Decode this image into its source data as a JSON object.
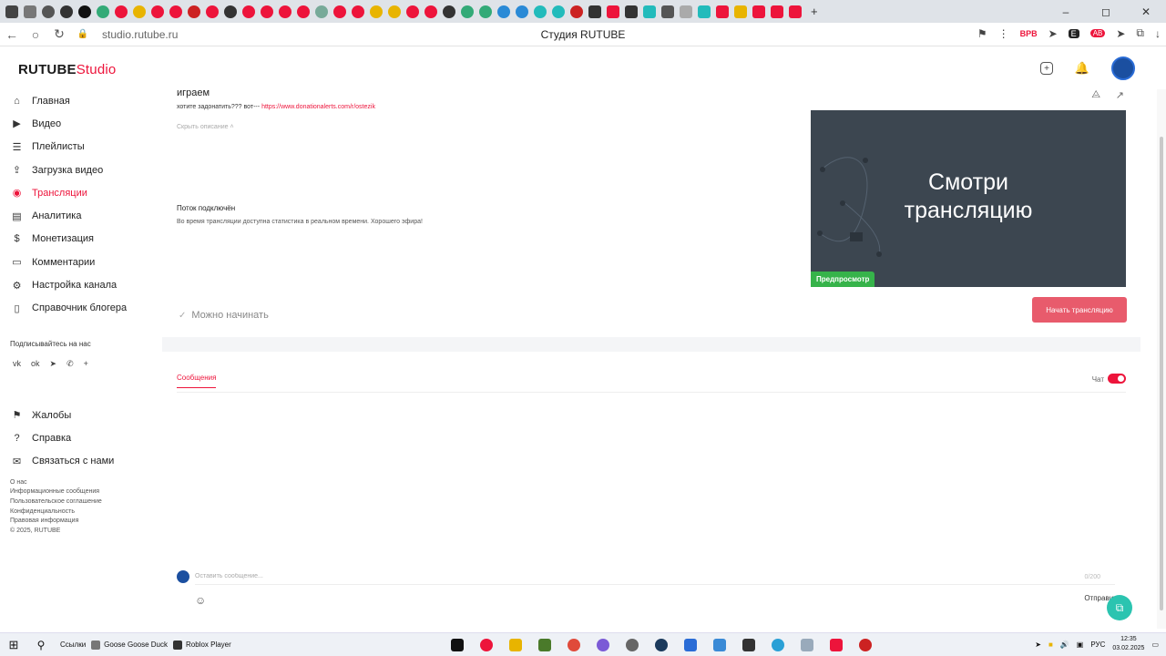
{
  "browser": {
    "url": "studio.rutube.ru",
    "title": "Студия RUTUBE",
    "tab_colors": [
      "#555",
      "#333",
      "#111",
      "#3a7",
      "#ed143b",
      "#e8b400",
      "#ed143b",
      "#ed143b",
      "#c22",
      "#ed143b",
      "#333",
      "#ed143b",
      "#ed143b",
      "#ed143b",
      "#ed143b",
      "#7a9",
      "#ed143b",
      "#ed143b",
      "#e8b400",
      "#e8b400",
      "#ed143b",
      "#ed143b",
      "#333",
      "#3a7",
      "#3a7",
      "#2a8ad6",
      "#2a8ad6",
      "#2bb",
      "#2bb",
      "#c22",
      "#333",
      "#ed143b",
      "#333",
      "#2bb",
      "#555",
      "#aaa",
      "#2bb",
      "#ed143b",
      "#e8b400",
      "#ed143b",
      "#ed143b",
      "#ed143b"
    ],
    "new_tab_label": "+"
  },
  "header": {
    "logo_main": "RUTUBE",
    "logo_studio": "Studio",
    "accent": "#ed143b"
  },
  "sidebar": {
    "items": [
      {
        "label": "Главная",
        "icon": "home-icon"
      },
      {
        "label": "Видео",
        "icon": "video-icon"
      },
      {
        "label": "Плейлисты",
        "icon": "playlist-icon"
      },
      {
        "label": "Загрузка видео",
        "icon": "upload-icon"
      },
      {
        "label": "Трансляции",
        "icon": "broadcast-icon",
        "active": true
      },
      {
        "label": "Аналитика",
        "icon": "analytics-icon"
      },
      {
        "label": "Монетизация",
        "icon": "monetization-icon"
      },
      {
        "label": "Комментарии",
        "icon": "comments-icon"
      },
      {
        "label": "Настройка канала",
        "icon": "settings-icon"
      },
      {
        "label": "Справочник блогера",
        "icon": "book-icon"
      }
    ],
    "subscribe_label": "Подписывайтесь на нас",
    "secondary_items": [
      {
        "label": "Жалобы",
        "icon": "flag-icon"
      },
      {
        "label": "Справка",
        "icon": "help-icon"
      },
      {
        "label": "Связаться с нами",
        "icon": "mail-icon"
      }
    ],
    "footer_links": [
      "О нас",
      "Информационные сообщения",
      "Пользовательское соглашение",
      "Конфиденциальность",
      "Правовая информация",
      "© 2025, RUTUBE"
    ]
  },
  "stream": {
    "title": "играем",
    "desc_prefix": "хотите задонатить??? вот---",
    "desc_link": "https://www.donationalerts.com/r/ostezik",
    "hide_desc": "Скрыть описание",
    "connected_title": "Поток подключён",
    "connected_text": "Во время трансляции доступна статистика в реальном времени. Хорошего эфира!",
    "ready_label": "Можно начинать",
    "preview_line1": "Смотри",
    "preview_line2": "трансляцию",
    "preview_badge": "Предпросмотр",
    "start_button": "Начать трансляцию"
  },
  "chat": {
    "tab_messages": "Сообщения",
    "chat_label": "Чат",
    "chat_enabled": true,
    "input_placeholder": "Оставить сообщение...",
    "counter": "0/200",
    "send_label": "Отправить"
  },
  "taskbar": {
    "links_label": "Ссылки",
    "items": [
      "Goose Goose Duck",
      "Roblox Player"
    ],
    "lang": "РУС",
    "time": "12:35",
    "date": "03.02.2025"
  }
}
